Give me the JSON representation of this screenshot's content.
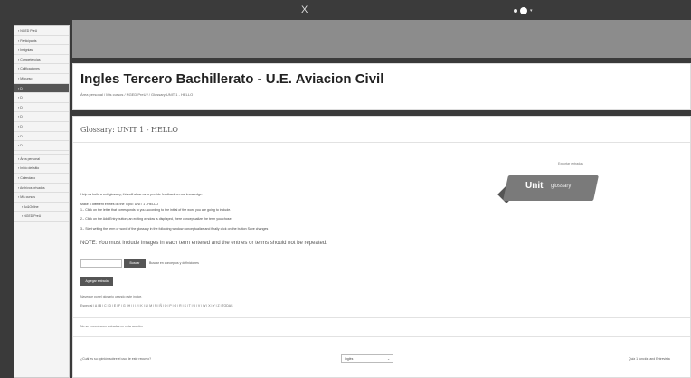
{
  "topbar": {
    "close_symbol": "X"
  },
  "drawer": {
    "items": [
      {
        "label": "NGED PreU",
        "icon": "cap-icon"
      },
      {
        "label": "Participants",
        "icon": "users-icon"
      },
      {
        "label": "Insignias",
        "icon": "badge-icon"
      },
      {
        "label": "Competencias",
        "icon": "check-icon"
      },
      {
        "label": "Calificaciones",
        "icon": "grades-icon"
      },
      {
        "label": "Mi curso",
        "icon": "folder-icon"
      },
      {
        "label": "D",
        "icon": "folder-icon",
        "active": true
      },
      {
        "label": "D",
        "icon": "folder-icon"
      },
      {
        "label": "D",
        "icon": "folder-icon"
      },
      {
        "label": "D",
        "icon": "folder-icon"
      },
      {
        "label": "D",
        "icon": "folder-icon"
      },
      {
        "label": "D",
        "icon": "folder-icon"
      },
      {
        "label": "D",
        "icon": "folder-icon"
      }
    ],
    "items2": [
      {
        "label": "Área personal",
        "icon": "home-icon"
      },
      {
        "label": "Inicio del sitio",
        "icon": "house-icon"
      },
      {
        "label": "Calendario",
        "icon": "calendar-icon"
      },
      {
        "label": "Archivos privados",
        "icon": "file-icon"
      },
      {
        "label": "Mis cursos",
        "icon": "cap-icon"
      },
      {
        "label": "Ac&Online",
        "icon": "cap-icon",
        "indent": true
      },
      {
        "label": "NGED PreU",
        "icon": "cap-icon",
        "indent": true
      }
    ]
  },
  "page": {
    "title": "Ingles Tercero Bachillerato - U.E. Aviacion Civil",
    "breadcrumb": "Área personal  /  Mis cursos  /  NGED PreU  /  /  Glossary UNIT 1 - HELLO"
  },
  "glossary": {
    "title": "Glossary: UNIT 1 - HELLO",
    "export_link": "Exportar entradas",
    "badge_unit": "Unit",
    "badge_word": "glossary",
    "para1": "Help us build a unit glossary, this will allow us to provide feedback on our knowledge.",
    "para2": "Make 5 different entries on the Topic: UNIT 1 - HELLO",
    "step1": "1.- Click on the letter that corresponds to you according to the initial of the word you are going to include.",
    "step2": "2.- Click on the Add Entry button, an editing window is displayed, there conceptualize the term you chose.",
    "step3": "3.- Start writing the term or word of the glossary in the following window conceptualize and finally click on the button Save changes",
    "note": "NOTE: You must include images in each term entered and the entries or terms should not be repeated.",
    "search_button": "Buscar",
    "search_checkbox": "Buscar en conceptos y definiciones",
    "add_button": "Agregar entrada",
    "browse_hint": "Navegue por el glosario usando este índice.",
    "alphabet": "Especial | A | B | C | D | E | F | G | H | I | J | K | L | M | N | Ñ | O | P | Q | R | S | T | U | V | W | X | Y | Z | TODAS",
    "empty_text": "No se encontraron entradas en esta sección",
    "footer_question": "¿Cuál es su opinión sobre el uso de este recurso?",
    "lang_value": "Inglés",
    "footer_link": "Quiz 1 función and Entrevista"
  }
}
